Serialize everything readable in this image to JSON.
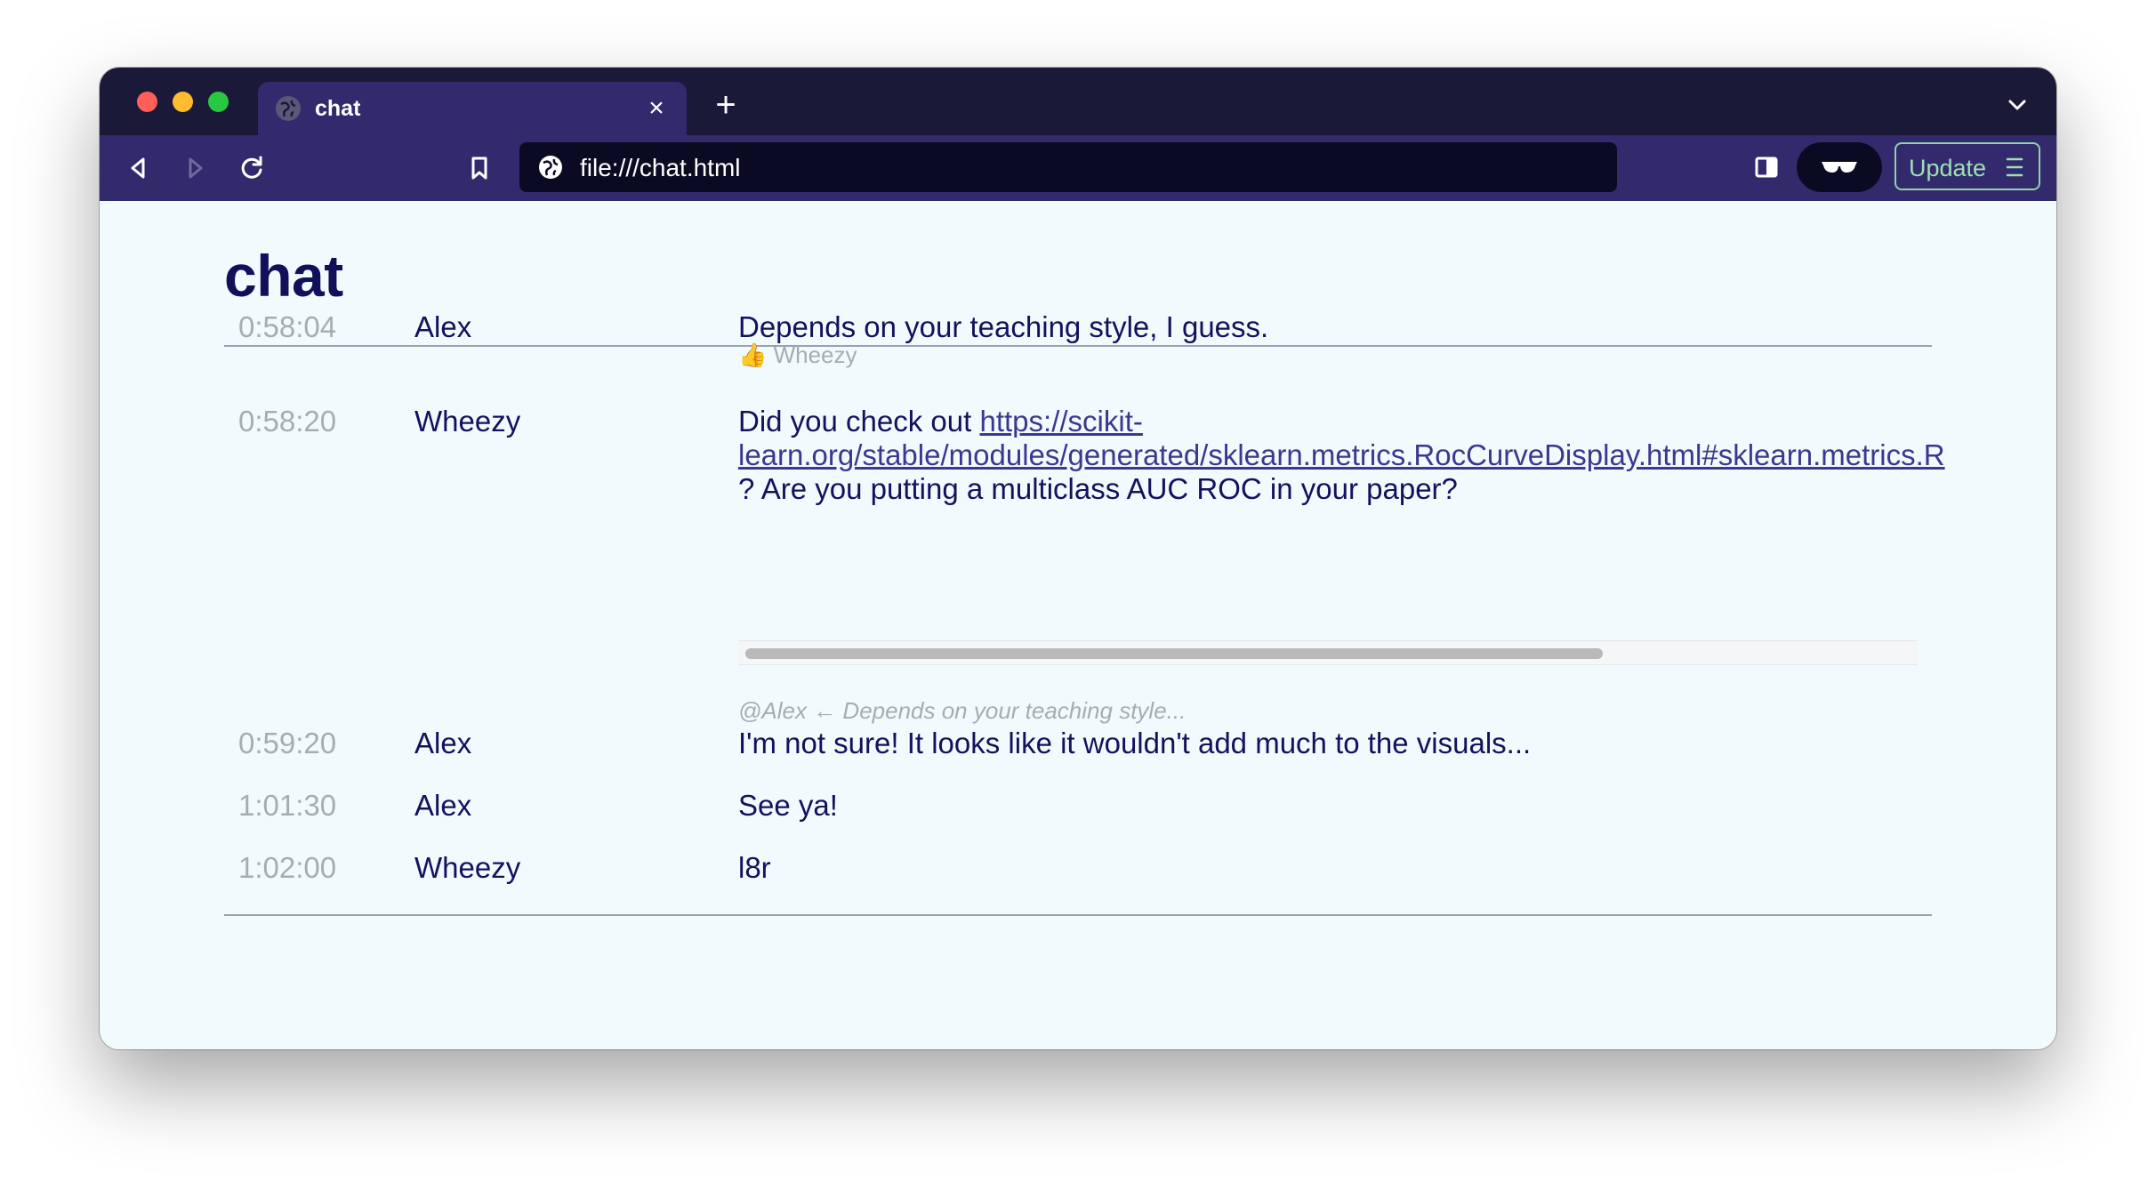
{
  "browser": {
    "tab": {
      "title": "chat",
      "close_glyph": "×"
    },
    "new_tab_glyph": "+",
    "address": "file:///chat.html",
    "update_label": "Update",
    "icons": {
      "back": "back-arrow-icon",
      "forward": "forward-arrow-icon",
      "reload": "reload-icon",
      "bookmark": "bookmark-icon",
      "globe": "globe-icon",
      "sidebar": "sidebar-icon",
      "privacy": "sunglasses-icon",
      "menu": "hamburger-menu-icon",
      "tab_list": "chevron-down-icon"
    },
    "colors": {
      "tabbar": "#1a1938",
      "toolbar": "#332a6e",
      "urlbar": "#0b0a23",
      "update_accent": "#9ee0b2"
    }
  },
  "page": {
    "title": "chat",
    "colors": {
      "background": "#f1fbfd",
      "text": "#12125e",
      "muted": "#a7acb4",
      "link": "#3a3890"
    }
  },
  "messages": [
    {
      "time": "0:58:04",
      "user": "Alex",
      "text": "Depends on your teaching style, I guess.",
      "reaction": "👍 Wheezy"
    },
    {
      "time": "0:58:20",
      "user": "Wheezy",
      "text_before": "Did you check out ",
      "link_line1": "https://scikit-",
      "link_line2": "learn.org/stable/modules/generated/sklearn.metrics.RocCurveDisplay.html#sklearn.metrics.R",
      "text_after": "? Are you putting a multiclass AUC ROC in your paper?"
    },
    {
      "reply_to": "@Alex ← Depends on your teaching style...",
      "time": "0:59:20",
      "user": "Alex",
      "text": "I'm not sure! It looks like it wouldn't add much to the visuals..."
    },
    {
      "time": "1:01:30",
      "user": "Alex",
      "text": "See ya!"
    },
    {
      "time": "1:02:00",
      "user": "Wheezy",
      "text": "l8r"
    }
  ]
}
